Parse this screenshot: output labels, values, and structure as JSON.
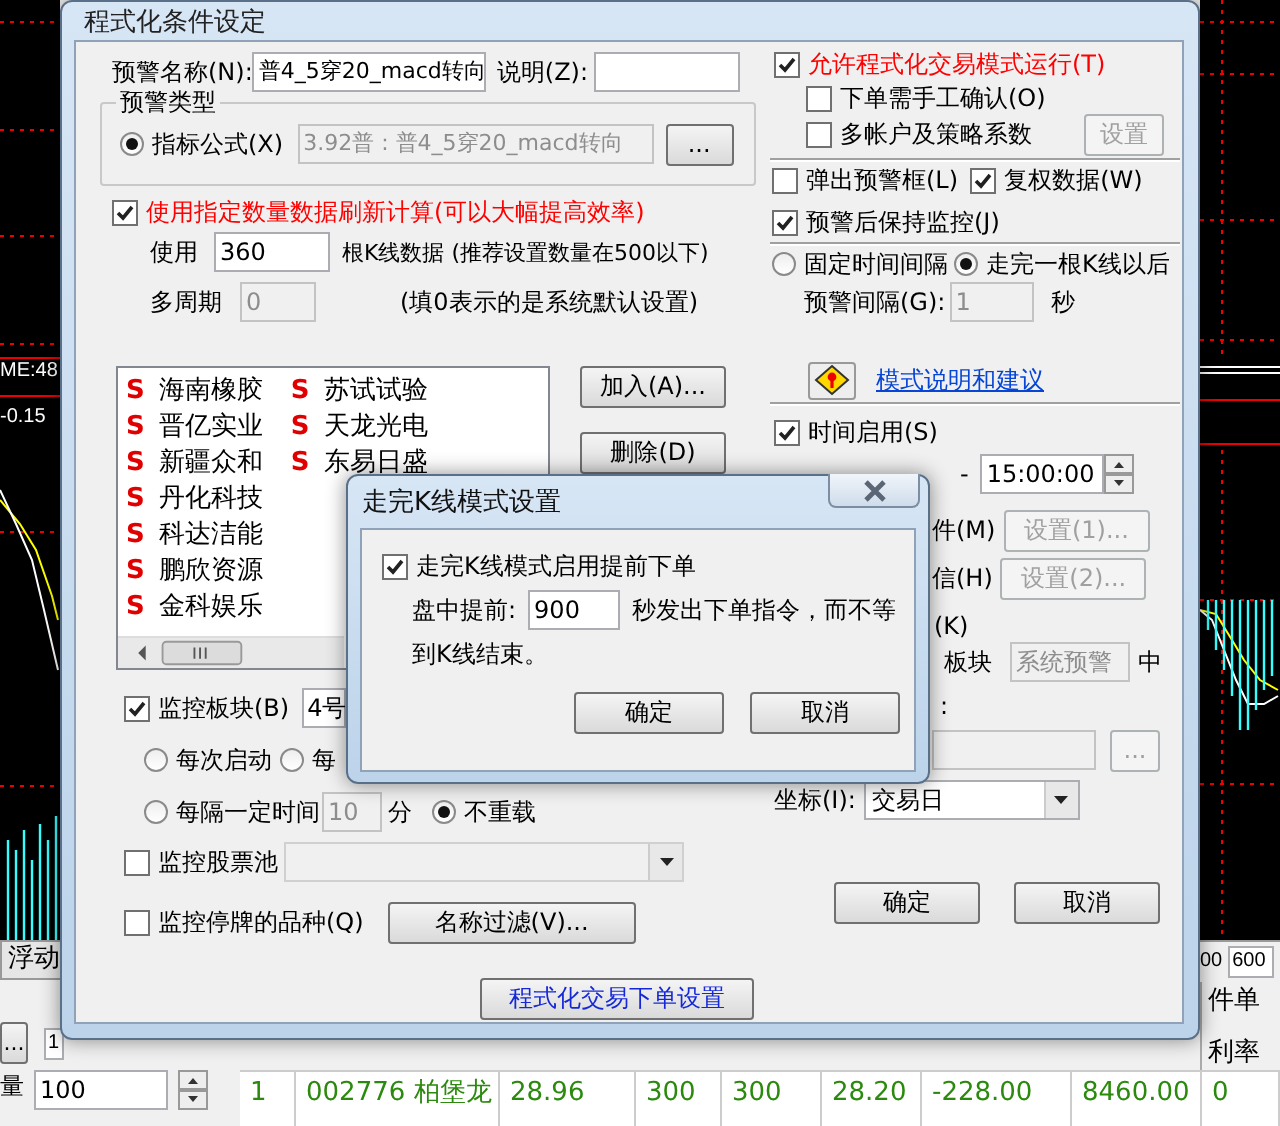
{
  "background_app": {
    "chart_readings": [
      "ME:48",
      "-0.15"
    ],
    "tab": "浮动",
    "right_fragment": "00",
    "right_field": "600",
    "header_fragments": [
      "件单",
      "利率"
    ],
    "order_button": "...",
    "order_field": "1",
    "quantity_label": "量",
    "quantity": "100",
    "table_row": [
      "1",
      "002776 柏堡龙",
      "28.96",
      "300",
      "300",
      "28.20",
      "-228.00",
      "8460.00",
      "0"
    ]
  },
  "main_dialog": {
    "title": "程式化条件设定",
    "alert_name": {
      "label": "预警名称(N):",
      "value": "普4_5穿20_macd转向"
    },
    "note": {
      "label": "说明(Z):"
    },
    "alert_type": {
      "legend": "预警类型",
      "option": {
        "label": "指标公式(X)",
        "selected": true
      },
      "formula": "3.92普 : 普4_5穿20_macd转向",
      "browse_button": "..."
    },
    "refresh": {
      "label": "使用指定数量数据刷新计算(可以大幅提高效率)",
      "checked": true
    },
    "bars": {
      "label": "使用",
      "value": "360",
      "hint": "根K线数据 (推荐设置数量在500以下)"
    },
    "multi_period": {
      "label": "多周期",
      "value": "0",
      "disabled": true,
      "hint": "(填0表示的是系统默认设置)"
    },
    "stock_list": [
      [
        {
          "mark": "S",
          "name": "海南橡胶"
        },
        {
          "mark": "S",
          "name": "晋亿实业"
        },
        {
          "mark": "S",
          "name": "新疆众和"
        },
        {
          "mark": "S",
          "name": "丹化科技"
        },
        {
          "mark": "S",
          "name": "科达洁能"
        },
        {
          "mark": "S",
          "name": "鹏欣资源"
        },
        {
          "mark": "S",
          "name": "金科娱乐"
        }
      ],
      [
        {
          "mark": "S",
          "name": "苏试试验"
        },
        {
          "mark": "S",
          "name": "天龙光电"
        },
        {
          "mark": "S",
          "name": "东易日盛"
        }
      ]
    ],
    "list_buttons": [
      "加入(A)...",
      "删除(D)"
    ],
    "monitor_block": {
      "label": "监控板块(B)",
      "checked": true,
      "value": "4号"
    },
    "reload_options": [
      {
        "label": "每次启动",
        "selected": false
      },
      {
        "label": "每",
        "selected": false
      }
    ],
    "interval": {
      "option": {
        "label": "每隔一定时间",
        "selected": false
      },
      "value": "10",
      "disabled": true,
      "unit": "分",
      "no_reload": {
        "label": "不重载",
        "selected": true
      }
    },
    "stock_pool": {
      "label": "监控股票池",
      "checked": false,
      "combo_disabled": true
    },
    "suspended": {
      "label": "监控停牌的品种(Q)",
      "checked": false
    },
    "name_filter_button": "名称过滤(V)...",
    "order_settings_button": "程式化交易下单设置",
    "allow_trading": {
      "label": "允许程式化交易模式运行(T)",
      "checked": true
    },
    "manual_confirm": {
      "label": "下单需手工确认(O)",
      "checked": false
    },
    "multi_account": {
      "label": "多帐户及策略系数",
      "checked": false
    },
    "settings_button": {
      "label": "设置",
      "disabled": true
    },
    "popup": {
      "label": "弹出预警框(L)",
      "checked": false
    },
    "adjusted": {
      "label": "复权数据(W)",
      "checked": true
    },
    "keep_monitoring": {
      "label": "预警后保持监控(J)",
      "checked": true
    },
    "timing": [
      {
        "label": "固定时间间隔",
        "selected": false
      },
      {
        "label": "走完一根K线以后",
        "selected": true
      }
    ],
    "alert_interval": {
      "label": "预警间隔(G):",
      "value": "1",
      "disabled": true,
      "unit": "秒"
    },
    "help_link": "模式说明和建议",
    "time_enabled": {
      "label": "时间启用(S)",
      "checked": true
    },
    "time_separator": "-",
    "end_time": "15:00:00",
    "condition_rows": [
      {
        "label": "件(M)",
        "button": "设置(1)...",
        "disabled": true
      },
      {
        "label": "信(H)",
        "button": "设置(2)...",
        "disabled": true
      }
    ],
    "k_fragment": "(K)",
    "block": {
      "label": "板块",
      "value": "系统预警",
      "suffix": "中"
    },
    "colon_fragment": ":",
    "path_field": {
      "disabled": true,
      "button": "..."
    },
    "axis": {
      "label": "坐标(I):",
      "value": "交易日"
    },
    "ok": "确定",
    "cancel": "取消"
  },
  "kline_dialog": {
    "title": "走完K线模式设置",
    "early_order": {
      "label": "走完K线模式启用提前下单",
      "checked": true
    },
    "advance": {
      "label": "盘中提前:",
      "value": "900",
      "hint_lines": [
        "秒发出下单指令，而不等",
        "到K线结束。"
      ]
    },
    "buttons": [
      "确定",
      "取消"
    ]
  }
}
